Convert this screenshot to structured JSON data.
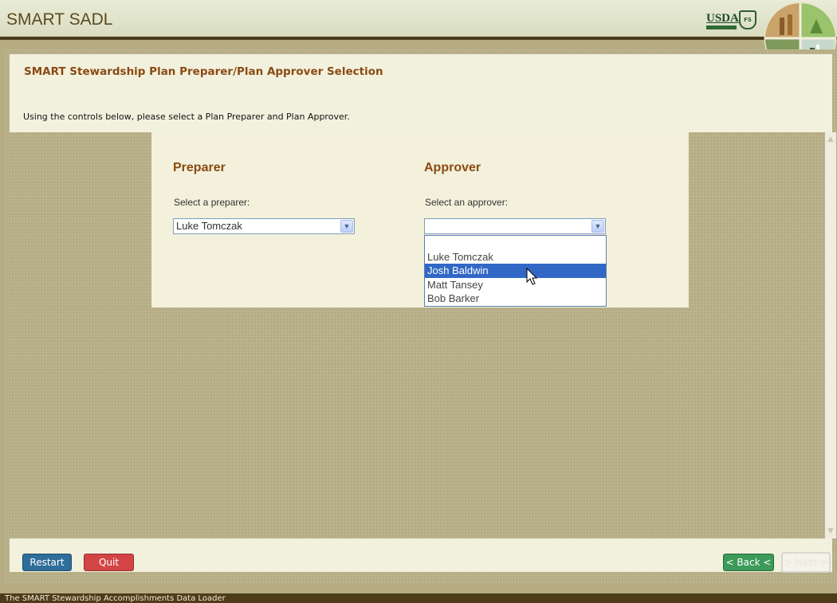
{
  "app": {
    "title": "SMART SADL",
    "usda_label": "USDA",
    "fs_label": "FS"
  },
  "page": {
    "title": "SMART Stewardship Plan Preparer/Plan Approver Selection",
    "instruction": "Using the controls below, please select a Plan Preparer and Plan Approver."
  },
  "preparer": {
    "heading": "Preparer",
    "label": "Select a preparer:",
    "selected": "Luke Tomczak"
  },
  "approver": {
    "heading": "Approver",
    "label": "Select an approver:",
    "selected": "",
    "options": [
      "",
      "Luke Tomczak",
      "Josh Baldwin",
      "Matt Tansey",
      "Bob Barker"
    ],
    "highlighted": "Josh Baldwin"
  },
  "footer": {
    "restart_label": "Restart",
    "quit_label": "Quit",
    "back_label": "< Back <",
    "next_label": "> Next >"
  },
  "status_bar": {
    "text": "The SMART Stewardship Accomplishments Data Loader"
  },
  "colors": {
    "accent": "#8b4a12",
    "header_border": "#4b3a1c",
    "background": "#b5ac84",
    "panel": "#f2f1de",
    "highlight": "#3168c5",
    "restart": "#2f6e9a",
    "quit": "#d34545",
    "back": "#3c9a5a"
  },
  "icons": {
    "usda_logo": "usda-logo-icon",
    "emblem": "circular-landscape-emblem-icon",
    "dropdown_arrow": "chevron-down-icon",
    "cursor": "mouse-pointer-icon"
  }
}
